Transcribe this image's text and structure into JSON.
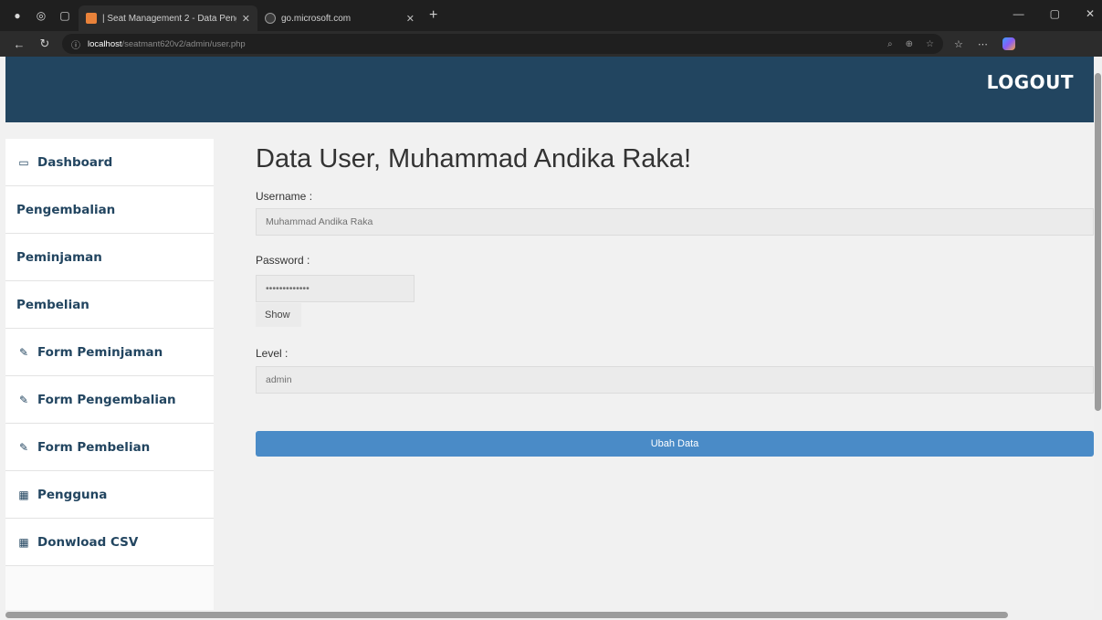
{
  "browser": {
    "tabs": [
      {
        "title": "| Seat Management 2 - Data Peng",
        "active": true
      },
      {
        "title": "go.microsoft.com",
        "active": false
      }
    ],
    "url_host": "localhost",
    "url_path": "/seatmant620v2/admin/user.php",
    "colors": {
      "chrome_dark": "#1f1f1f",
      "chrome_bar": "#2c2c2c"
    }
  },
  "header": {
    "logout_label": "LOGOUT",
    "color": "#224560"
  },
  "sidebar": {
    "items": [
      {
        "label": "Dashboard",
        "icon": "monitor-icon"
      },
      {
        "label": "Pengembalian",
        "icon": ""
      },
      {
        "label": "Peminjaman",
        "icon": ""
      },
      {
        "label": "Pembelian",
        "icon": ""
      },
      {
        "label": "Form Peminjaman",
        "icon": "edit-icon"
      },
      {
        "label": "Form Pengembalian",
        "icon": "edit-icon"
      },
      {
        "label": "Form Pembelian",
        "icon": "edit-icon"
      },
      {
        "label": "Pengguna",
        "icon": "table-icon"
      },
      {
        "label": "Donwload CSV",
        "icon": "table-icon"
      }
    ]
  },
  "main": {
    "title": "Data User, Muhammad Andika Raka!",
    "username_label": "Username :",
    "username_value": "Muhammad Andika Raka",
    "password_label": "Password :",
    "password_value": "•••••••••••••",
    "show_label": "Show",
    "level_label": "Level :",
    "level_value": "admin",
    "submit_label": "Ubah Data",
    "accent": "#4a8bc7"
  }
}
